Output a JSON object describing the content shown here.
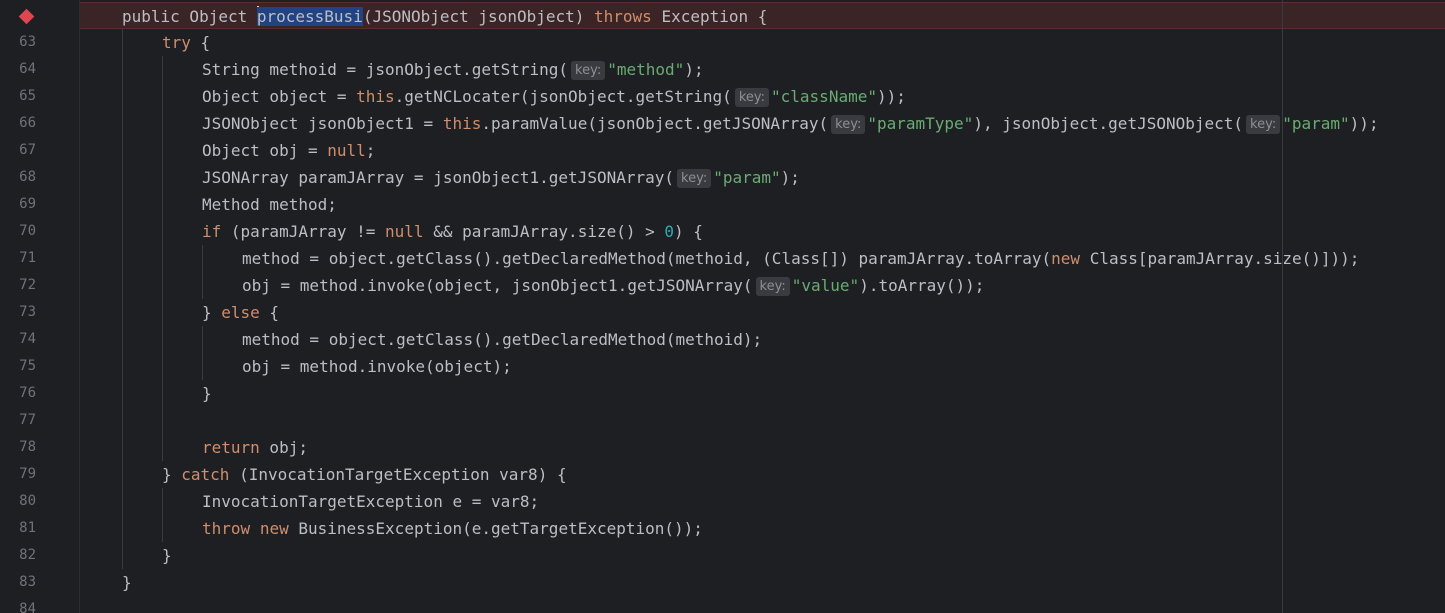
{
  "editor": {
    "breakpoint_icon": "breakpoint-diamond-icon",
    "colors": {
      "background": "#1e1f22",
      "default_text": "#bcbec4",
      "keyword": "#cf8e6d",
      "string": "#6aab73",
      "number": "#2aacb8",
      "line_number": "#6f737a",
      "breakpoint_line_bg": "#3b2426",
      "breakpoint_icon": "#e0464f",
      "inlay_hint_bg": "#393b40",
      "selection": "#214283"
    },
    "lines": [
      {
        "number": "",
        "indent": 1,
        "breakpoint": true,
        "tokens": [
          {
            "t": "public Object ",
            "c": ""
          },
          {
            "t": "",
            "c": "caret"
          },
          {
            "t": "processBusi",
            "c": "sel"
          },
          {
            "t": "(JSONObject jsonObject) ",
            "c": ""
          },
          {
            "t": "throws",
            "c": "kw"
          },
          {
            "t": " Exception {",
            "c": ""
          }
        ]
      },
      {
        "number": "63",
        "indent": 2,
        "tokens": [
          {
            "t": "try",
            "c": "kw"
          },
          {
            "t": " {",
            "c": ""
          }
        ]
      },
      {
        "number": "64",
        "indent": 3,
        "tokens": [
          {
            "t": "String methoid = jsonObject.getString(",
            "c": ""
          },
          {
            "t": "key:",
            "c": "hint"
          },
          {
            "t": "\"method\"",
            "c": "str"
          },
          {
            "t": ");",
            "c": ""
          }
        ]
      },
      {
        "number": "65",
        "indent": 3,
        "tokens": [
          {
            "t": "Object object = ",
            "c": ""
          },
          {
            "t": "this",
            "c": "kw"
          },
          {
            "t": ".getNCLocater(jsonObject.getString(",
            "c": ""
          },
          {
            "t": "key:",
            "c": "hint"
          },
          {
            "t": "\"className\"",
            "c": "str"
          },
          {
            "t": "));",
            "c": ""
          }
        ]
      },
      {
        "number": "66",
        "indent": 3,
        "tokens": [
          {
            "t": "JSONObject jsonObject1 = ",
            "c": ""
          },
          {
            "t": "this",
            "c": "kw"
          },
          {
            "t": ".paramValue(jsonObject.getJSONArray(",
            "c": ""
          },
          {
            "t": "key:",
            "c": "hint"
          },
          {
            "t": "\"paramType\"",
            "c": "str"
          },
          {
            "t": "), jsonObject.getJSONObject(",
            "c": ""
          },
          {
            "t": "key:",
            "c": "hint"
          },
          {
            "t": "\"param\"",
            "c": "str"
          },
          {
            "t": "));",
            "c": ""
          }
        ]
      },
      {
        "number": "67",
        "indent": 3,
        "tokens": [
          {
            "t": "Object obj = ",
            "c": ""
          },
          {
            "t": "null",
            "c": "kw"
          },
          {
            "t": ";",
            "c": ""
          }
        ]
      },
      {
        "number": "68",
        "indent": 3,
        "tokens": [
          {
            "t": "JSONArray paramJArray = jsonObject1.getJSONArray(",
            "c": ""
          },
          {
            "t": "key:",
            "c": "hint"
          },
          {
            "t": "\"param\"",
            "c": "str"
          },
          {
            "t": ");",
            "c": ""
          }
        ]
      },
      {
        "number": "69",
        "indent": 3,
        "tokens": [
          {
            "t": "Method method;",
            "c": ""
          }
        ]
      },
      {
        "number": "70",
        "indent": 3,
        "tokens": [
          {
            "t": "if",
            "c": "kw"
          },
          {
            "t": " (paramJArray != ",
            "c": ""
          },
          {
            "t": "null",
            "c": "kw"
          },
          {
            "t": " && paramJArray.size() > ",
            "c": ""
          },
          {
            "t": "0",
            "c": "num"
          },
          {
            "t": ") {",
            "c": ""
          }
        ]
      },
      {
        "number": "71",
        "indent": 4,
        "tokens": [
          {
            "t": "method = object.getClass().getDeclaredMethod(methoid, (Class[]) paramJArray.toArray(",
            "c": ""
          },
          {
            "t": "new",
            "c": "kw"
          },
          {
            "t": " Class[paramJArray.size()]));",
            "c": ""
          }
        ]
      },
      {
        "number": "72",
        "indent": 4,
        "tokens": [
          {
            "t": "obj = method.invoke(object, jsonObject1.getJSONArray(",
            "c": ""
          },
          {
            "t": "key:",
            "c": "hint"
          },
          {
            "t": "\"value\"",
            "c": "str"
          },
          {
            "t": ").toArray());",
            "c": ""
          }
        ]
      },
      {
        "number": "73",
        "indent": 3,
        "tokens": [
          {
            "t": "} ",
            "c": ""
          },
          {
            "t": "else",
            "c": "kw"
          },
          {
            "t": " {",
            "c": ""
          }
        ]
      },
      {
        "number": "74",
        "indent": 4,
        "tokens": [
          {
            "t": "method = object.getClass().getDeclaredMethod(methoid);",
            "c": ""
          }
        ]
      },
      {
        "number": "75",
        "indent": 4,
        "tokens": [
          {
            "t": "obj = method.invoke(object);",
            "c": ""
          }
        ]
      },
      {
        "number": "76",
        "indent": 3,
        "tokens": [
          {
            "t": "}",
            "c": ""
          }
        ]
      },
      {
        "number": "77",
        "indent": 3,
        "tokens": []
      },
      {
        "number": "78",
        "indent": 3,
        "tokens": [
          {
            "t": "return",
            "c": "kw"
          },
          {
            "t": " obj;",
            "c": ""
          }
        ]
      },
      {
        "number": "79",
        "indent": 2,
        "tokens": [
          {
            "t": "} ",
            "c": ""
          },
          {
            "t": "catch",
            "c": "kw"
          },
          {
            "t": " (InvocationTargetException var8) {",
            "c": ""
          }
        ]
      },
      {
        "number": "80",
        "indent": 3,
        "tokens": [
          {
            "t": "InvocationTargetException e = var8;",
            "c": ""
          }
        ]
      },
      {
        "number": "81",
        "indent": 3,
        "tokens": [
          {
            "t": "throw",
            "c": "kw"
          },
          {
            "t": " ",
            "c": ""
          },
          {
            "t": "new",
            "c": "kw"
          },
          {
            "t": " BusinessException(e.getTargetException());",
            "c": ""
          }
        ]
      },
      {
        "number": "82",
        "indent": 2,
        "tokens": [
          {
            "t": "}",
            "c": ""
          }
        ]
      },
      {
        "number": "83",
        "indent": 1,
        "tokens": [
          {
            "t": "}",
            "c": ""
          }
        ]
      },
      {
        "number": "84",
        "indent": 1,
        "tokens": []
      }
    ]
  }
}
